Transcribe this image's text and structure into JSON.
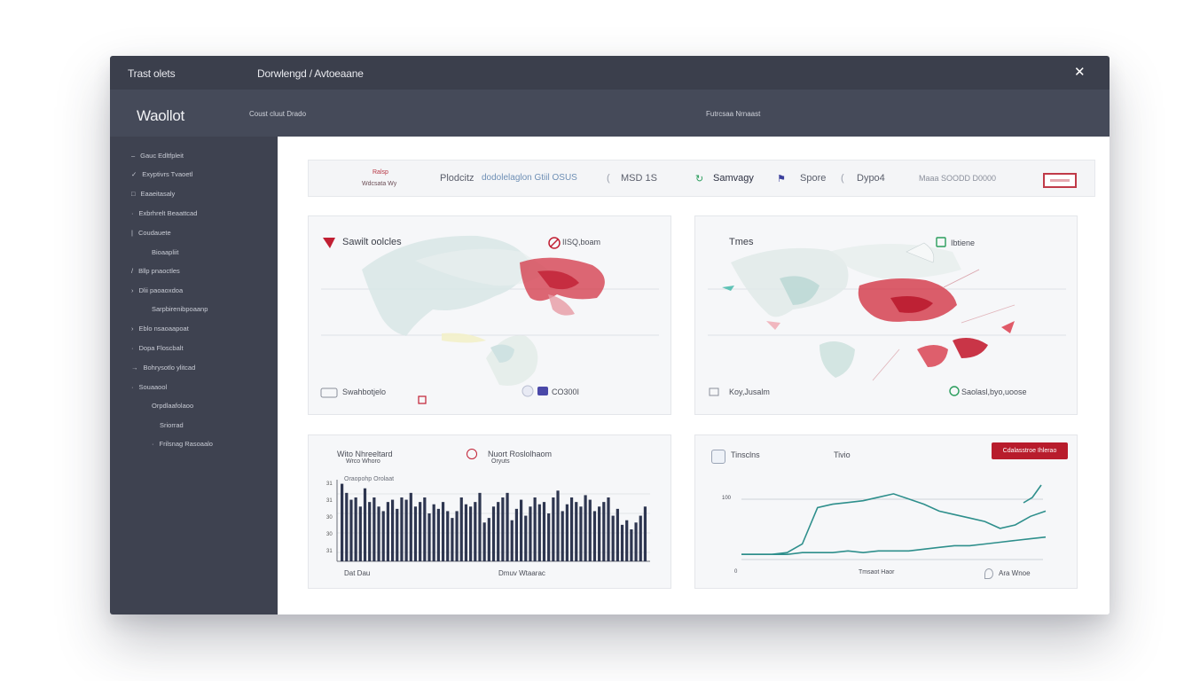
{
  "window": {
    "title_left": "Trast olets",
    "title_mid": "Dorwlengd / Avtoeaane"
  },
  "header": {
    "brand": "Waollot",
    "left_text": "Coust  cluut  Drado",
    "mid_text": "Futrcsaa  Nrnaast"
  },
  "sidebar": {
    "items": [
      {
        "icon": "minus-icon",
        "label": "Gauc  Edltfpleit"
      },
      {
        "icon": "check-icon",
        "label": "Exyptivrs  Tvaoetl"
      },
      {
        "icon": "grid-icon",
        "label": "Eaaeitasaly"
      },
      {
        "icon": "dot-icon",
        "label": "Exbrhrelt  Beaattcad"
      },
      {
        "icon": "bar-icon",
        "label": "Coudauete"
      },
      {
        "icon": "",
        "label": "Bioaapliit"
      },
      {
        "icon": "slash-icon",
        "label": "Bllp  pnaoctles"
      },
      {
        "icon": "chevron-icon",
        "label": "Dlii  paoaoxdoa"
      },
      {
        "icon": "",
        "label": "Sarpbirenibpoaanp"
      },
      {
        "icon": "chevron-icon",
        "label": "Eblo  nsaoaapoat"
      },
      {
        "icon": "dot-icon",
        "label": "Dopa  Floscbalt"
      },
      {
        "icon": "arrow-icon",
        "label": "Bohrysotlo  ylitcad"
      },
      {
        "icon": "dot-icon",
        "label": "Souaaool"
      },
      {
        "icon": "",
        "label": "Orpdlaafolaoo"
      },
      {
        "icon": "",
        "label": "Sriorrad"
      },
      {
        "icon": "dot-icon",
        "label": "Frilsnag  Rasoaalo"
      }
    ]
  },
  "toolbar": {
    "small_top": "Ralsp",
    "small_bottom": "Wdcsata  Wy",
    "item1": "Plodcitz",
    "item2": "dodolelaglon  Gtiil  OSUS",
    "item3": "MSD 1S",
    "item4": "Samvagy",
    "item5": "Spore",
    "item6": "Dypo4",
    "item7": "Maaa  SOODD  D0000"
  },
  "panel_map1": {
    "title": "Sawilt  oolcles",
    "badge": "IISQ,boam",
    "footer_left": "Swahbotjelo",
    "footer_right": "CO300I"
  },
  "panel_map2": {
    "title": "Tmes",
    "badge": "Ibtiene",
    "footer_left": "Koy,Jusalm",
    "footer_right": "Saolasl,byo,uoose"
  },
  "panel_bar": {
    "title": "Wito  Nhreeltard",
    "subtitle": "Wrco  Whoro",
    "title2": "Nuort  Roslolhaom",
    "subtitle2": "Oryuts",
    "legend": "Oraopohp  Orolaat",
    "footer_left": "Dat  Dau",
    "footer_right": "Dmuv  Wtaarac",
    "y_ticks": [
      "31",
      "31",
      "30",
      "30",
      "31"
    ]
  },
  "panel_line": {
    "title": "Tinsclns",
    "title2": "Tivio",
    "button": "Cdalasstroe  Ihlerao",
    "y_top": "100",
    "y_bottom": "0",
    "footer_mid": "Tmsaot  Haor",
    "footer_right": "Ara  Wnoe"
  },
  "chart_data": [
    {
      "type": "bar",
      "title": "",
      "values": [
        68,
        60,
        54,
        56,
        48,
        64,
        52,
        56,
        48,
        44,
        52,
        54,
        46,
        56,
        54,
        60,
        48,
        52,
        56,
        42,
        50,
        46,
        52,
        44,
        38,
        44,
        56,
        50,
        48,
        52,
        60,
        34,
        38,
        48,
        52,
        56,
        60,
        36,
        46,
        54,
        40,
        48,
        56,
        50,
        52,
        42,
        56,
        62,
        44,
        50,
        56,
        52,
        48,
        58,
        54,
        44,
        48,
        52,
        56,
        40,
        46,
        32,
        36,
        28,
        34,
        40,
        48
      ],
      "color": "#2e3650"
    },
    {
      "type": "line",
      "title": "",
      "series": [
        {
          "values": [
            3,
            3,
            3,
            4,
            9,
            30,
            32,
            33,
            34,
            36,
            38,
            35,
            32,
            28,
            26,
            24,
            22,
            18,
            20,
            25,
            28
          ],
          "color": "#2e8f8c"
        },
        {
          "values": [
            3,
            3,
            3,
            3,
            4,
            4,
            4,
            5,
            4,
            5,
            5,
            5,
            6,
            7,
            8,
            8,
            9,
            10,
            11,
            12,
            13
          ],
          "color": "#2e8f8c"
        }
      ]
    }
  ]
}
